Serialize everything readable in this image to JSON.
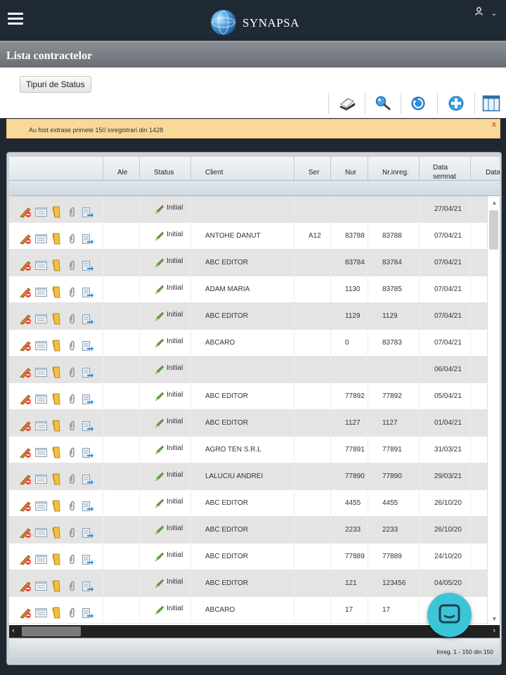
{
  "app": {
    "brand": "SYNAPSA"
  },
  "header": {
    "menu_icon": "hamburger-icon",
    "user_icon": "user-icon",
    "user_chevron": "⌄"
  },
  "page": {
    "title": "Lista contractelor"
  },
  "toolbar": {
    "status_types_label": "Tipuri de Status",
    "icons": [
      "print-icon",
      "search-icon",
      "refresh-icon",
      "add-icon",
      "columns-icon"
    ]
  },
  "info": {
    "message": "Au fost extrase primele 150 inregistrari din 1428",
    "close": "x"
  },
  "grid": {
    "columns": [
      {
        "key": "actions",
        "label": ""
      },
      {
        "key": "ale",
        "label": "Ale"
      },
      {
        "key": "status",
        "label": "Status"
      },
      {
        "key": "client",
        "label": "Client"
      },
      {
        "key": "ser",
        "label": "Ser"
      },
      {
        "key": "nur",
        "label": "Nur"
      },
      {
        "key": "nr_inreg",
        "label": "Nr.inreg."
      },
      {
        "key": "data_semnat",
        "label": "Data semnat"
      },
      {
        "key": "data",
        "label": "Data"
      }
    ],
    "rows": [
      {
        "status": "Initial",
        "client": "",
        "ser": "",
        "nur": "",
        "nr_inreg": "",
        "data_semnat": "27/04/21"
      },
      {
        "status": "Initial",
        "client": "ANTOHE DANUT",
        "ser": "A12",
        "nur": "83788",
        "nr_inreg": "83788",
        "data_semnat": "07/04/21"
      },
      {
        "status": "Initial",
        "client": "ABC EDITOR",
        "ser": "",
        "nur": "83784",
        "nr_inreg": "83784",
        "data_semnat": "07/04/21"
      },
      {
        "status": "Initial",
        "client": "ADAM MARIA",
        "ser": "",
        "nur": "1130",
        "nr_inreg": "83785",
        "data_semnat": "07/04/21"
      },
      {
        "status": "Initial",
        "client": "ABC EDITOR",
        "ser": "",
        "nur": "1129",
        "nr_inreg": "1129",
        "data_semnat": "07/04/21"
      },
      {
        "status": "Initial",
        "client": "ABCARO",
        "ser": "",
        "nur": "0",
        "nr_inreg": "83783",
        "data_semnat": "07/04/21"
      },
      {
        "status": "Initial",
        "client": "",
        "ser": "",
        "nur": "",
        "nr_inreg": "",
        "data_semnat": "06/04/21"
      },
      {
        "status": "Initial",
        "client": "ABC EDITOR",
        "ser": "",
        "nur": "77892",
        "nr_inreg": "77892",
        "data_semnat": "05/04/21"
      },
      {
        "status": "Initial",
        "client": "ABC EDITOR",
        "ser": "",
        "nur": "1127",
        "nr_inreg": "1127",
        "data_semnat": "01/04/21"
      },
      {
        "status": "Initial",
        "client": "AGRO TEN S.R.L",
        "ser": "",
        "nur": "77891",
        "nr_inreg": "77891",
        "data_semnat": "31/03/21"
      },
      {
        "status": "Initial",
        "client": "LALUCIU ANDREI",
        "ser": "",
        "nur": "77890",
        "nr_inreg": "77890",
        "data_semnat": "29/03/21"
      },
      {
        "status": "Initial",
        "client": "ABC EDITOR",
        "ser": "",
        "nur": "4455",
        "nr_inreg": "4455",
        "data_semnat": "26/10/20"
      },
      {
        "status": "Initial",
        "client": "ABC EDITOR",
        "ser": "",
        "nur": "2233",
        "nr_inreg": "2233",
        "data_semnat": "26/10/20"
      },
      {
        "status": "Initial",
        "client": "ABC EDITOR",
        "ser": "",
        "nur": "77889",
        "nr_inreg": "77889",
        "data_semnat": "24/10/20"
      },
      {
        "status": "Initial",
        "client": "ABC EDITOR",
        "ser": "",
        "nur": "121",
        "nr_inreg": "123456",
        "data_semnat": "04/05/20"
      },
      {
        "status": "Initial",
        "client": "ABCARO",
        "ser": "",
        "nur": "17",
        "nr_inreg": "17",
        "data_semnat": ""
      }
    ],
    "row_actions": [
      "edit-icon",
      "details-icon",
      "folder-icon",
      "attachment-icon",
      "export-icon"
    ]
  },
  "pager": {
    "text": "Inreg. 1 - 150 din 150"
  },
  "chat": {
    "icon": "chat-icon"
  },
  "colors": {
    "topbar": "#1f2a34",
    "info_bg": "#f9d99a",
    "chat": "#3cc5d7",
    "row_alt": "#e4e4e4"
  }
}
